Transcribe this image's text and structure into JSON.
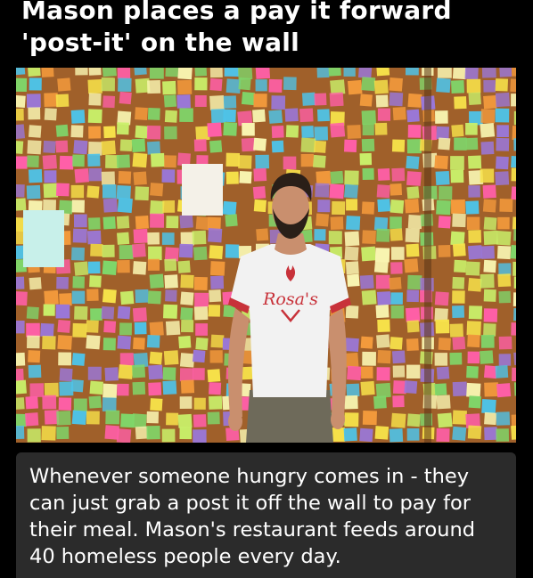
{
  "post": {
    "title_lines": [
      "Mason places a pay it forward",
      "'post-it' on the wall"
    ],
    "caption_lines": [
      "Whenever someone hungry comes in - they",
      "can just grab a post it off the wall to pay for",
      "their meal. Mason's restaurant feeds around",
      "40 homeless people every day."
    ]
  },
  "photo": {
    "shirt_logo": "Rosa's",
    "colors": {
      "wall": "#a0602a",
      "shirt": "#f2f2f2",
      "shirt_trim": "#c8323a",
      "pants": "#6e6a5a",
      "skin": "#c98f6e",
      "hair": "#2a1f18"
    },
    "note_colors": [
      "#f7e24a",
      "#ff5fa8",
      "#7fd66a",
      "#4ec3e8",
      "#f39a3c",
      "#9a77d8",
      "#c9f06a",
      "#f8f4b0"
    ]
  }
}
